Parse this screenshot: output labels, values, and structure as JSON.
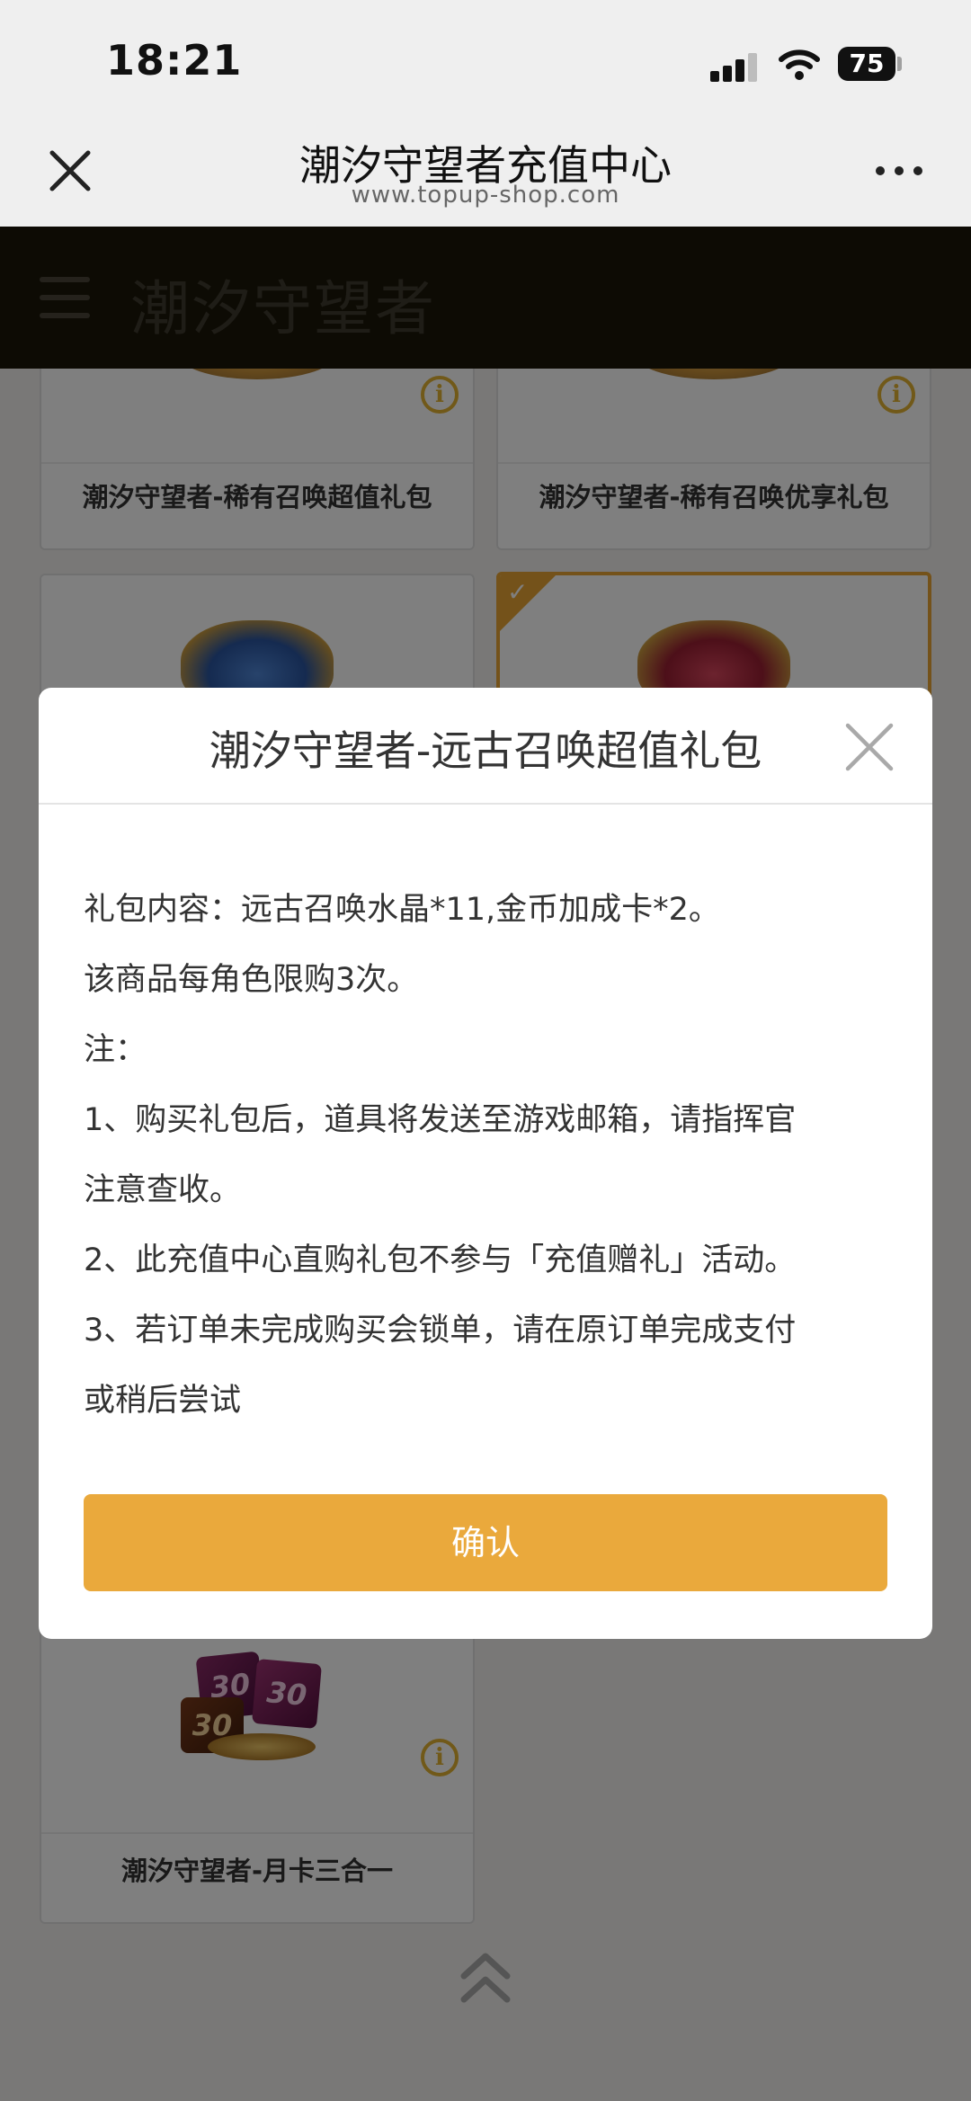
{
  "status_bar": {
    "time": "18:21",
    "battery": "75"
  },
  "browser": {
    "title": "潮汐守望者充值中心",
    "url": "www.topup-shop.com"
  },
  "site": {
    "logo_text": "潮汐守望者"
  },
  "products": [
    {
      "label": "潮汐守望者-稀有召唤超值礼包",
      "selected": false
    },
    {
      "label": "潮汐守望者-稀有召唤优享礼包",
      "selected": false
    },
    {
      "label": "",
      "selected": false
    },
    {
      "label": "",
      "selected": true
    },
    {
      "label": "潮汐守望者-月卡三合一",
      "selected": false
    }
  ],
  "monthcard_art": {
    "badge_1": "30",
    "badge_2": "30",
    "badge_3": "30"
  },
  "info_icon_glyph": "i",
  "modal": {
    "title": "潮汐守望者-远古召唤超值礼包",
    "lines": [
      "礼包内容：远古召唤水晶*11,金币加成卡*2。",
      "该商品每角色限购3次。",
      "注：",
      "1、购买礼包后，道具将发送至游戏邮箱，请指挥官",
      "注意查收。",
      "2、此充值中心直购礼包不参与「充值赠礼」活动。",
      "3、若订单未完成购买会锁单，请在原订单完成支付",
      "或稍后尝试"
    ],
    "confirm_label": "确认"
  },
  "colors": {
    "accent": "#eaa93c",
    "selected_border": "#e8a534",
    "info_icon": "#e3b233"
  },
  "icons": {
    "close": "close-icon",
    "more": "more-icon",
    "menu": "hamburger-icon",
    "info": "info-icon",
    "check": "checkmark-icon",
    "scroll_top": "double-chevron-up-icon"
  }
}
